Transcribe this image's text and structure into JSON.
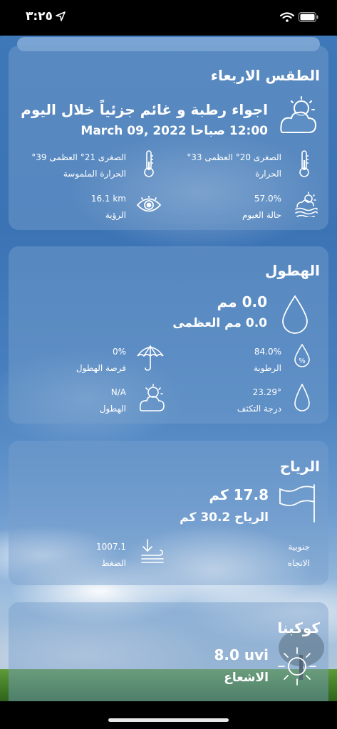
{
  "status_bar": {
    "time": "٣:٢٥"
  },
  "current": {
    "title": "الطقس الاربعاء",
    "condition": "اجواء رطبة و غائم جزئياً خلال اليوم",
    "datetime": "12:00 صباحا March 09, 2022",
    "temp_range": "الصغرى 20° العظمى 33°",
    "temp_label": "الحرارة",
    "feels_range": "الصغرى 21° العظمى 39°",
    "feels_label": "الحرارة الملموسة",
    "cloud_value": "57.0%",
    "cloud_label": "حالة الغيوم",
    "visibility_value": "16.1 km",
    "visibility_label": "الرؤية"
  },
  "precipitation": {
    "title": "الهطول",
    "amount": "0.0 مم",
    "max": "0.0 مم العظمى",
    "humidity_value": "84.0%",
    "humidity_label": "الرطوبة",
    "chance_value": "0%",
    "chance_label": "فرصة الهطول",
    "dew_value": "23.29°",
    "dew_label": "درجة التكثف",
    "precip_value": "N/A",
    "precip_label": "الهطول"
  },
  "wind": {
    "title": "الرياح",
    "speed": "17.8 كم",
    "gust": "الرياح 30.2 كم",
    "direction_value": "جنوبية",
    "direction_label": "الاتجاه",
    "pressure_value": "1007.1",
    "pressure_label": "الضغط"
  },
  "planets": {
    "title": "كوكبنا",
    "uv_value": "8.0 uvi",
    "uv_label": "الاشعاع"
  }
}
